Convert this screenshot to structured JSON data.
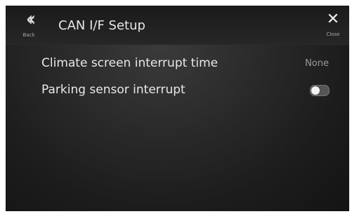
{
  "header": {
    "title": "CAN I/F Setup",
    "back_label": "Back",
    "back_icon": "double-chevron-left",
    "close_label": "Close",
    "close_icon": "close-x"
  },
  "settings": [
    {
      "label": "Climate screen interrupt time",
      "value": "None"
    },
    {
      "label": "Parking sensor interrupt",
      "toggle_state": "off"
    }
  ]
}
